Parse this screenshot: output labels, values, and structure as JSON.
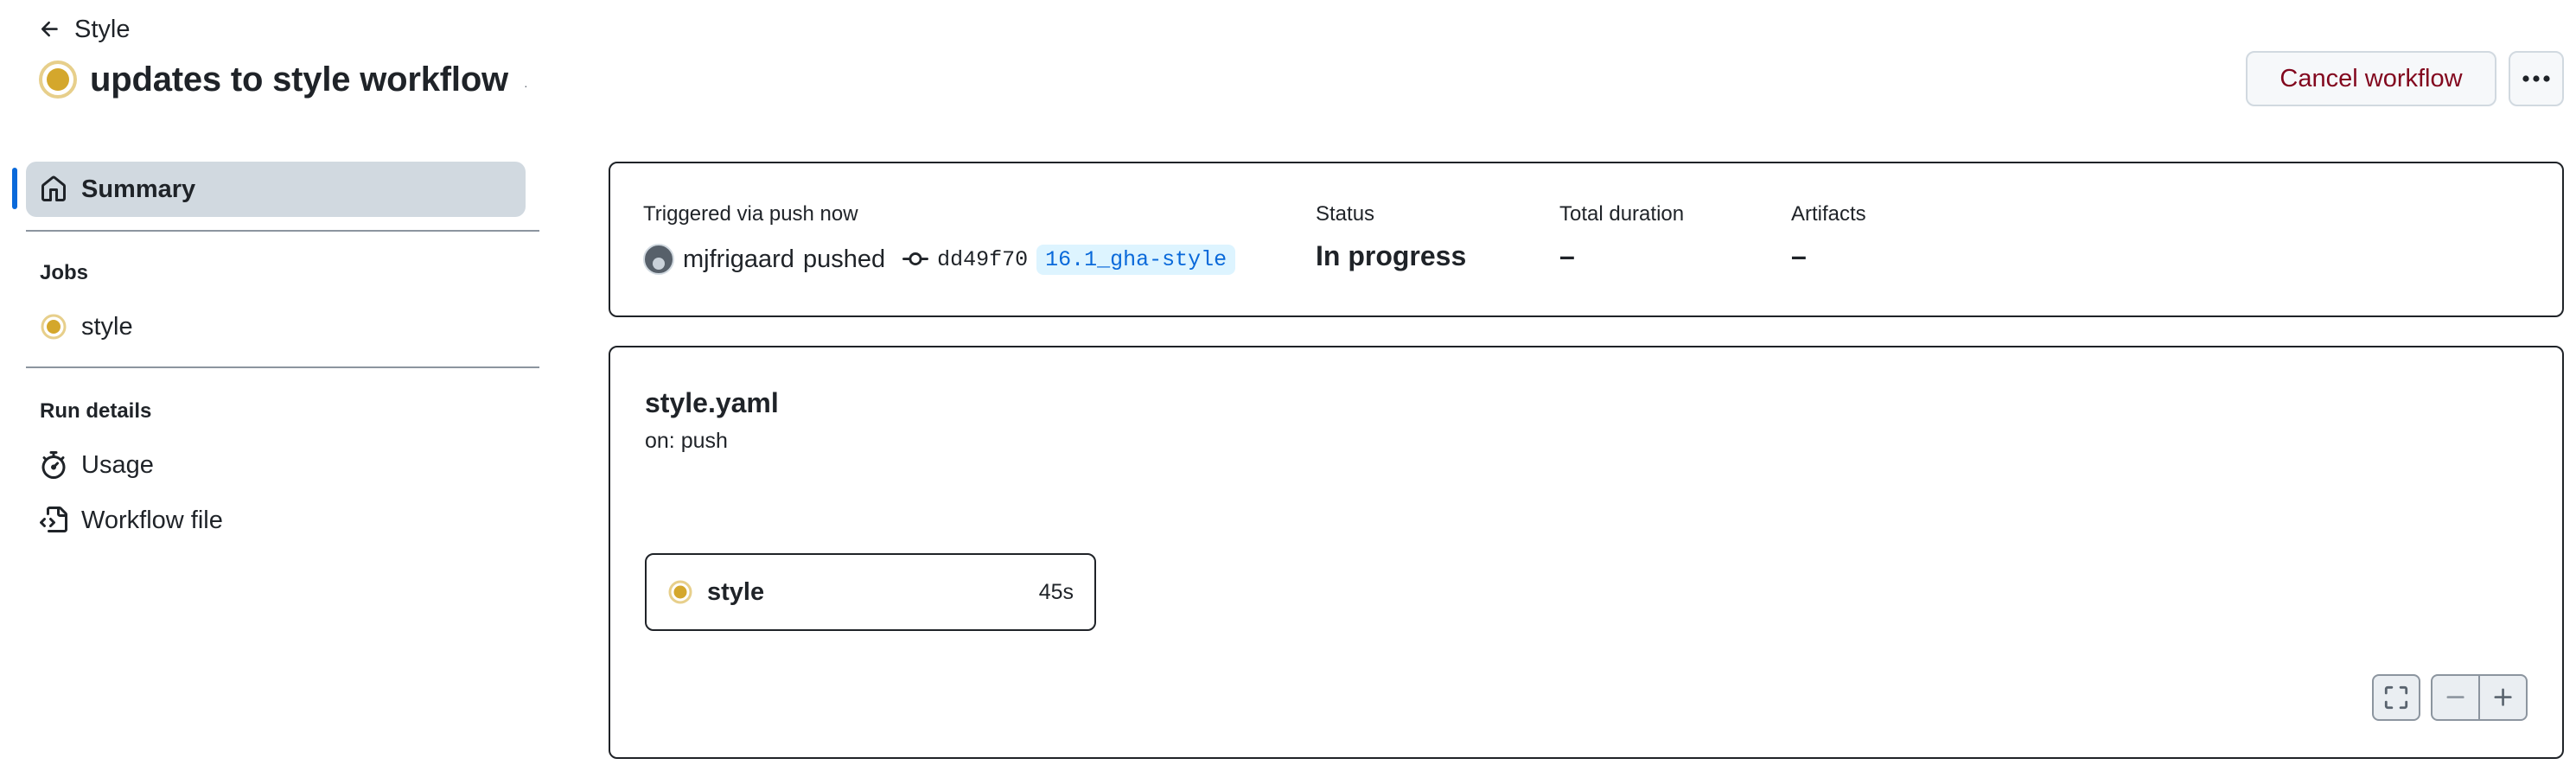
{
  "header": {
    "back_label": "Style",
    "title": "updates to style workflow",
    "title_suffix": "·",
    "cancel_label": "Cancel workflow",
    "status_color": "#d4a72c"
  },
  "sidebar": {
    "summary_label": "Summary",
    "jobs_heading": "Jobs",
    "jobs": [
      {
        "label": "style",
        "status": "in-progress"
      }
    ],
    "run_details_heading": "Run details",
    "run_details": [
      {
        "label": "Usage",
        "icon": "stopwatch-icon"
      },
      {
        "label": "Workflow file",
        "icon": "file-code-icon"
      }
    ]
  },
  "summary": {
    "trigger_label": "Triggered via push now",
    "actor": "mjfrigaard",
    "action": "pushed",
    "commit_sha": "dd49f70",
    "branch": "16.1_gha-style",
    "status_label": "Status",
    "status_value": "In progress",
    "duration_label": "Total duration",
    "duration_value": "–",
    "artifacts_label": "Artifacts",
    "artifacts_value": "–"
  },
  "graph": {
    "workflow_file": "style.yaml",
    "on_event": "on: push",
    "job_name": "style",
    "job_duration": "45s"
  },
  "colors": {
    "accent": "#0969da",
    "danger": "#82071e",
    "in_progress": "#d4a72c"
  }
}
